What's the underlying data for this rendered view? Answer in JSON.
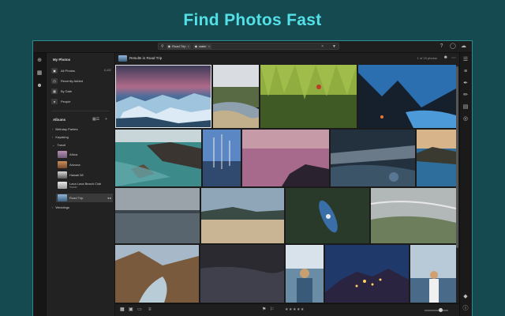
{
  "headline": "Find Photos Fast",
  "colors": {
    "accent": "#53e0e6",
    "background": "#144a50",
    "app": "#1b1b1b"
  },
  "search": {
    "chips": [
      {
        "label": "Road Trip",
        "icon": "location-icon"
      },
      {
        "label": "water",
        "icon": "tag-icon"
      }
    ]
  },
  "sidebar": {
    "my_photos_header": "My Photos",
    "items": [
      {
        "label": "All Photos",
        "count": "6,432",
        "icon": "photos-icon"
      },
      {
        "label": "Recently Added",
        "count": "",
        "icon": "clock-icon"
      },
      {
        "label": "By Date",
        "count": "",
        "icon": "calendar-icon"
      },
      {
        "label": "People",
        "count": "",
        "icon": "person-icon"
      }
    ],
    "albums_header": "Albums",
    "albums": [
      {
        "label": "Birthday Parties",
        "sub": ""
      },
      {
        "label": "Kayaking",
        "sub": ""
      },
      {
        "label": "Travel",
        "sub": ""
      },
      {
        "label": "Africa",
        "sub": ""
      },
      {
        "label": "Arizona",
        "sub": ""
      },
      {
        "label": "Hawaii 08",
        "sub": ""
      },
      {
        "label": "Lava Lava Beach Club",
        "sub": "Hawaii"
      },
      {
        "label": "Road Trip",
        "sub": ""
      },
      {
        "label": "Weddings",
        "sub": ""
      }
    ]
  },
  "main": {
    "title": "Results in Road Trip",
    "count": "1 of 15 photos"
  },
  "photos": [
    {
      "name": "photo-icebergs",
      "theme": "icebergs"
    },
    {
      "name": "photo-river-bend",
      "theme": "riverbend"
    },
    {
      "name": "photo-willow-pond",
      "theme": "willow"
    },
    {
      "name": "photo-mountain-lake",
      "theme": "mountainlake"
    },
    {
      "name": "photo-rocky-coast",
      "theme": "rockycoast"
    },
    {
      "name": "photo-dead-trees",
      "theme": "deadtrees"
    },
    {
      "name": "photo-pink-sea",
      "theme": "pinksea"
    },
    {
      "name": "photo-night-harbor",
      "theme": "nightharbor"
    },
    {
      "name": "photo-coast-bay",
      "theme": "coastbay"
    },
    {
      "name": "photo-misty-shore",
      "theme": "mistyshore"
    },
    {
      "name": "photo-sandy-beach",
      "theme": "sandybeach"
    },
    {
      "name": "photo-kayak",
      "theme": "kayak"
    },
    {
      "name": "photo-waves",
      "theme": "waves"
    },
    {
      "name": "photo-canyon-river",
      "theme": "canyon"
    },
    {
      "name": "photo-dark-water",
      "theme": "darkwater"
    },
    {
      "name": "photo-woman-lake",
      "theme": "woman"
    },
    {
      "name": "photo-night-village",
      "theme": "village"
    },
    {
      "name": "photo-girl-sea",
      "theme": "girl"
    }
  ],
  "bottombar": {
    "view_icons": [
      "grid-view-icon",
      "square-view-icon",
      "detail-view-icon",
      "sort-icon"
    ],
    "rating_stars": "★★★★★",
    "flag_icons": [
      "flag-icon",
      "flag-outline-icon"
    ]
  }
}
